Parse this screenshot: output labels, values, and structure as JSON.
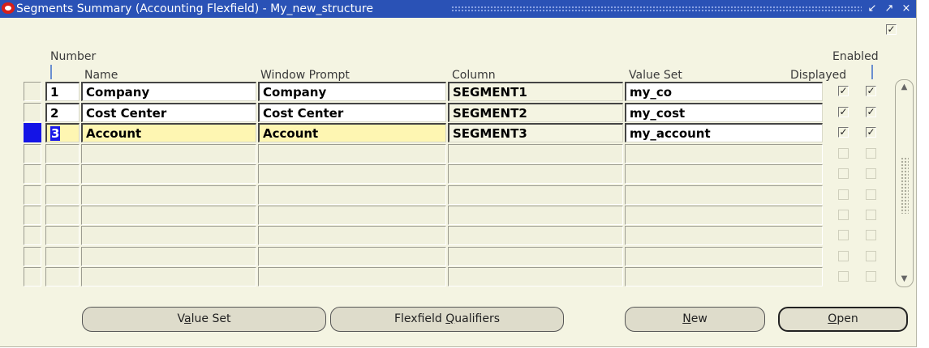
{
  "window": {
    "title": "Segments Summary (Accounting Flexfield) - My_new_structure",
    "controls": [
      "↙",
      "↗",
      "×"
    ],
    "top_checkbox_checked": true
  },
  "headers": {
    "number": "Number",
    "name": "Name",
    "window_prompt": "Window Prompt",
    "column": "Column",
    "value_set": "Value Set",
    "displayed": "Displayed",
    "enabled": "Enabled"
  },
  "rows": [
    {
      "number": "1",
      "name": "Company",
      "prompt": "Company",
      "column": "SEGMENT1",
      "value_set": "my_co",
      "displayed": true,
      "enabled": true
    },
    {
      "number": "2",
      "name": "Cost Center",
      "prompt": "Cost Center",
      "column": "SEGMENT2",
      "value_set": "my_cost",
      "displayed": true,
      "enabled": true
    },
    {
      "number": "3",
      "name": "Account",
      "prompt": "Account",
      "column": "SEGMENT3",
      "value_set": "my_account",
      "displayed": true,
      "enabled": true
    }
  ],
  "empty_row_count": 7,
  "buttons": {
    "value_set": {
      "pre": "V",
      "ul": "a",
      "post": "lue Set"
    },
    "flexfield_qualifiers": {
      "pre": "Flexfield ",
      "ul": "Q",
      "post": "ualifiers"
    },
    "new": {
      "pre": "",
      "ul": "N",
      "post": "ew"
    },
    "open": {
      "pre": "",
      "ul": "O",
      "post": "pen"
    }
  },
  "colors": {
    "titlebar": "#2a52b6",
    "background": "#f4f4e2",
    "current_row": "#fef6b2",
    "selection": "#1414e6"
  }
}
